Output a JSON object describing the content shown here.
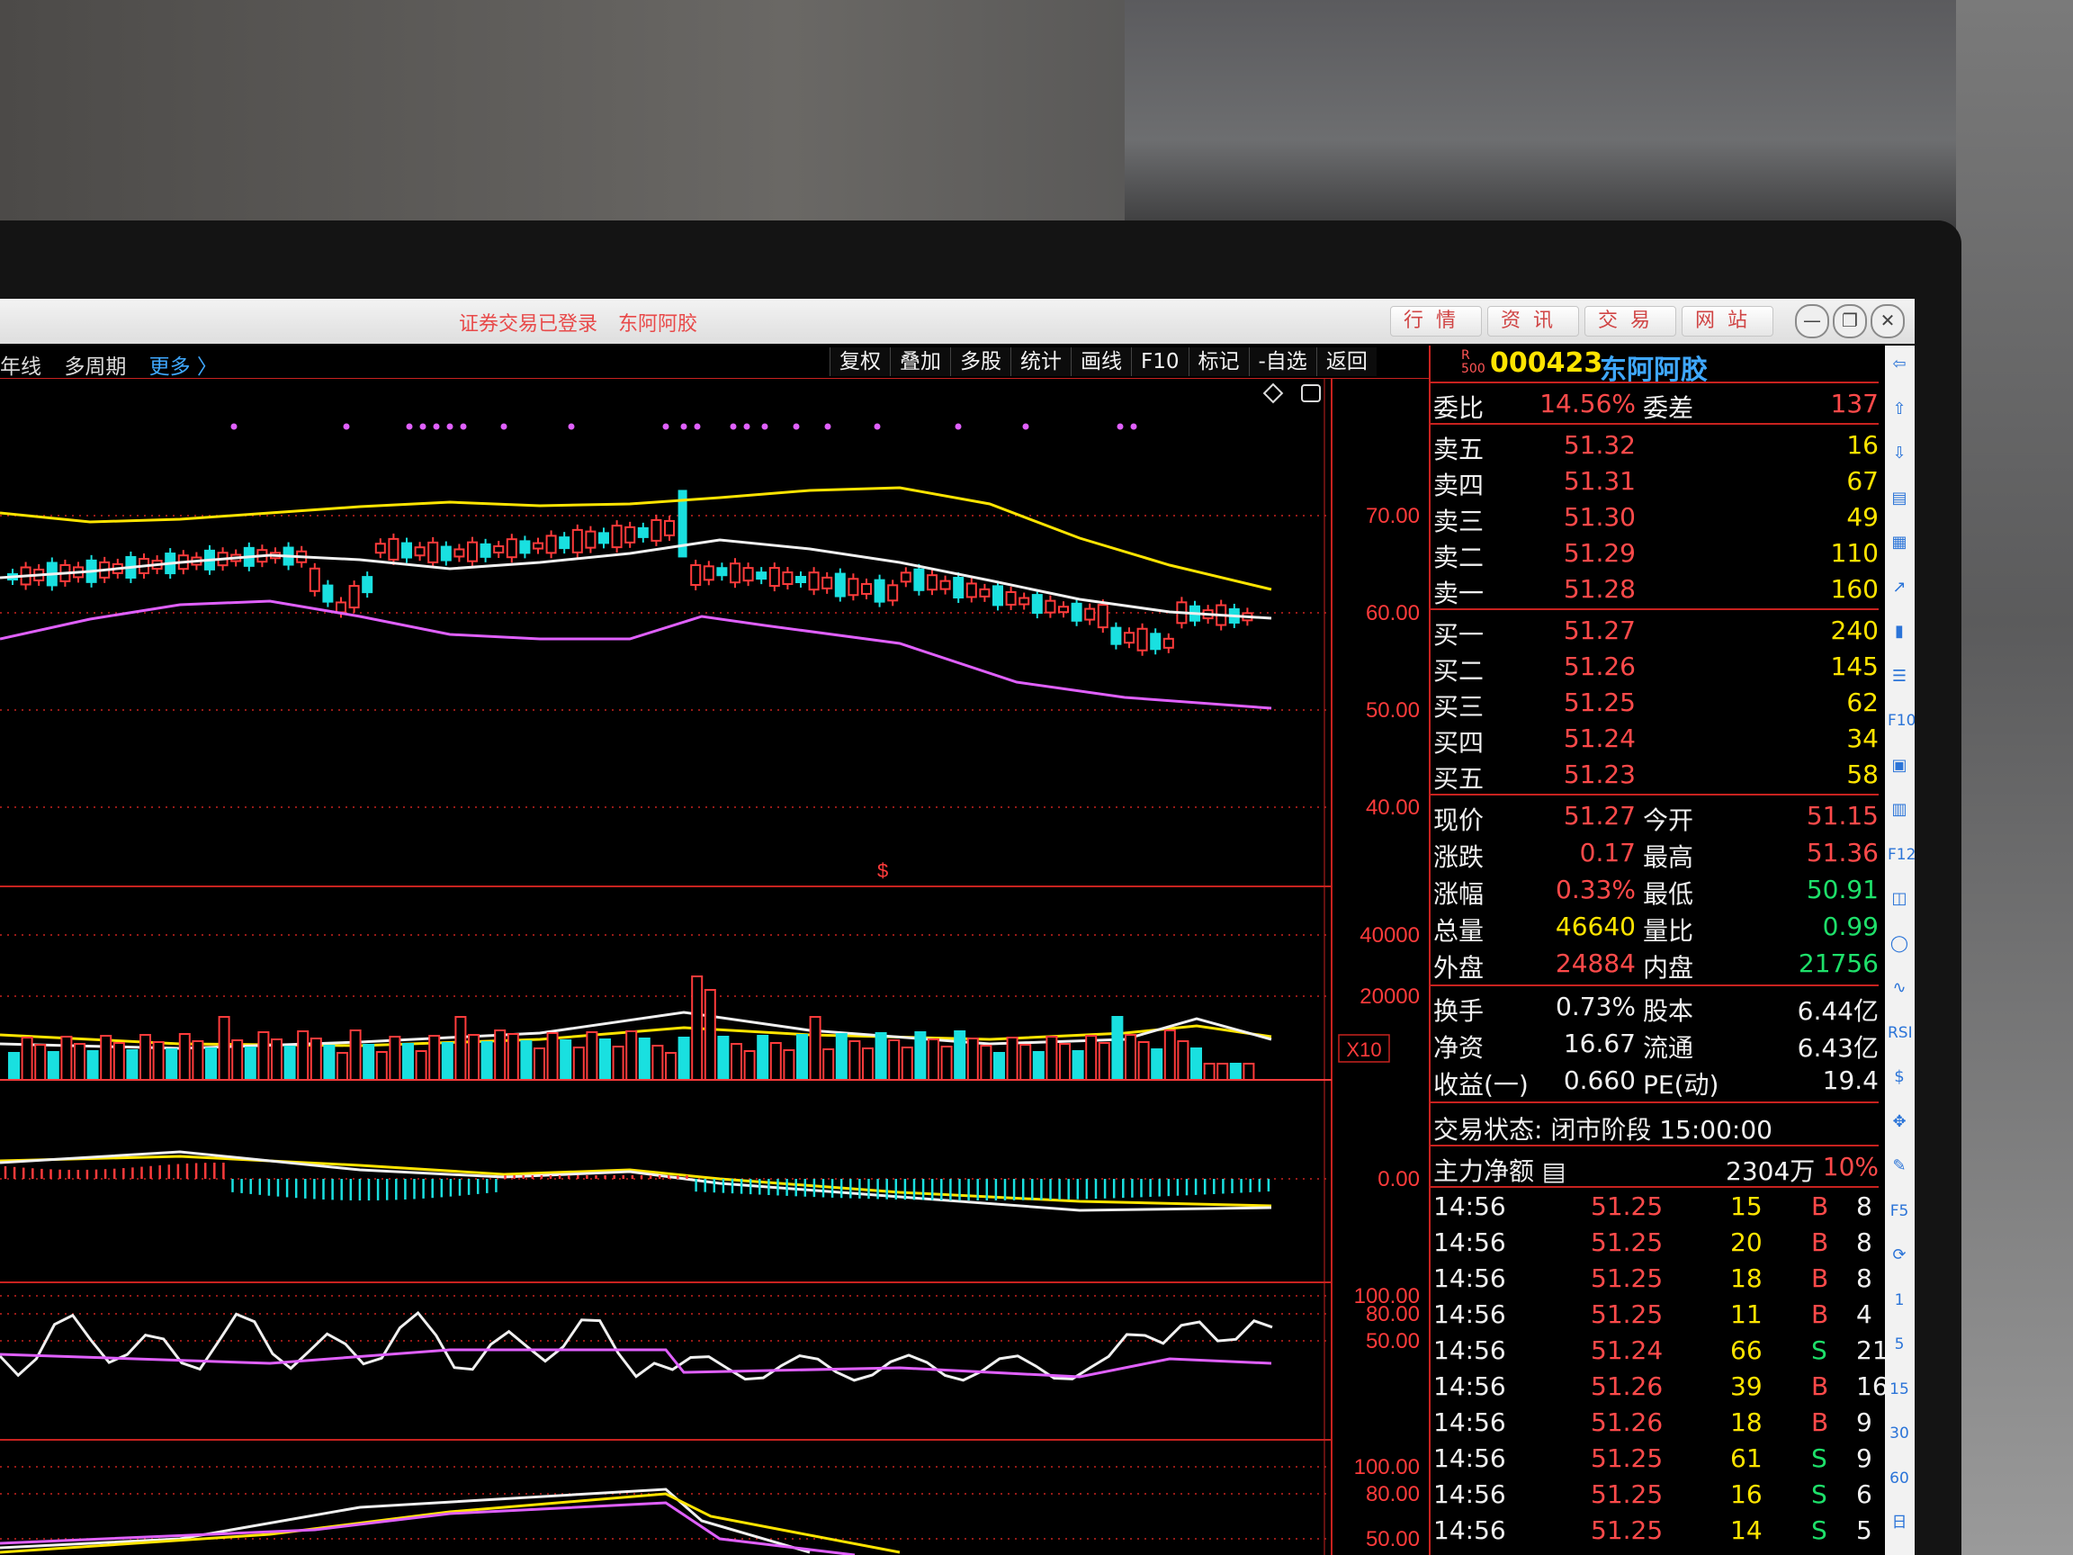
{
  "window": {
    "title_parts": [
      "证券交易已登录",
      "东阿阿胶"
    ],
    "nav_tabs": [
      "行情",
      "资讯",
      "交易",
      "网站"
    ],
    "controls": [
      "—",
      "❐",
      "✕"
    ]
  },
  "toolbar": {
    "left_items": [
      "年线",
      "多周期"
    ],
    "more_label": "更多 〉",
    "buttons": [
      "复权",
      "叠加",
      "多股",
      "统计",
      "画线",
      "F10",
      "标记",
      "-自选",
      "返回"
    ]
  },
  "stock": {
    "badge_r": "R",
    "badge_500": "500",
    "code": "000423",
    "name": "东阿阿胶"
  },
  "quote": {
    "weibi": {
      "label": "委比",
      "value": "14.56%",
      "label2": "委差",
      "value2": "137"
    },
    "asks": [
      {
        "label": "卖五",
        "price": "51.32",
        "vol": "16"
      },
      {
        "label": "卖四",
        "price": "51.31",
        "vol": "67"
      },
      {
        "label": "卖三",
        "price": "51.30",
        "vol": "49"
      },
      {
        "label": "卖二",
        "price": "51.29",
        "vol": "110"
      },
      {
        "label": "卖一",
        "price": "51.28",
        "vol": "160"
      }
    ],
    "bids": [
      {
        "label": "买一",
        "price": "51.27",
        "vol": "240"
      },
      {
        "label": "买二",
        "price": "51.26",
        "vol": "145"
      },
      {
        "label": "买三",
        "price": "51.25",
        "vol": "62"
      },
      {
        "label": "买四",
        "price": "51.24",
        "vol": "34"
      },
      {
        "label": "买五",
        "price": "51.23",
        "vol": "58"
      }
    ],
    "stats": [
      {
        "l1": "现价",
        "v1": "51.27",
        "l2": "今开",
        "v2": "51.15"
      },
      {
        "l1": "涨跌",
        "v1": "0.17",
        "l2": "最高",
        "v2": "51.36"
      },
      {
        "l1": "涨幅",
        "v1": "0.33%",
        "l2": "最低",
        "v2": "50.91"
      },
      {
        "l1": "总量",
        "v1": "46640",
        "l2": "量比",
        "v2": "0.99"
      },
      {
        "l1": "外盘",
        "v1": "24884",
        "l2": "内盘",
        "v2": "21756"
      }
    ],
    "fundamentals": [
      {
        "l1": "换手",
        "v1": "0.73%",
        "l2": "股本",
        "v2": "6.44亿"
      },
      {
        "l1": "净资",
        "v1": "16.67",
        "l2": "流通",
        "v2": "6.43亿"
      },
      {
        "l1": "收益(一)",
        "v1": "0.660",
        "l2": "PE(动)",
        "v2": "19.4"
      }
    ],
    "trade_status": "交易状态: 闭市阶段 15:00:00",
    "main_net": {
      "label": "主力净额",
      "value": "2304万",
      "pct": "10%"
    }
  },
  "ticks": [
    {
      "time": "14:56",
      "price": "51.25",
      "vol": "15",
      "side": "B",
      "n": "8"
    },
    {
      "time": "14:56",
      "price": "51.25",
      "vol": "20",
      "side": "B",
      "n": "8"
    },
    {
      "time": "14:56",
      "price": "51.25",
      "vol": "18",
      "side": "B",
      "n": "8"
    },
    {
      "time": "14:56",
      "price": "51.25",
      "vol": "11",
      "side": "B",
      "n": "4"
    },
    {
      "time": "14:56",
      "price": "51.24",
      "vol": "66",
      "side": "S",
      "n": "21"
    },
    {
      "time": "14:56",
      "price": "51.26",
      "vol": "39",
      "side": "B",
      "n": "16"
    },
    {
      "time": "14:56",
      "price": "51.26",
      "vol": "18",
      "side": "B",
      "n": "9"
    },
    {
      "time": "14:56",
      "price": "51.25",
      "vol": "61",
      "side": "S",
      "n": "9"
    },
    {
      "time": "14:56",
      "price": "51.25",
      "vol": "16",
      "side": "S",
      "n": "6"
    },
    {
      "time": "14:56",
      "price": "51.25",
      "vol": "14",
      "side": "S",
      "n": "5"
    }
  ],
  "axes": {
    "price": [
      "70.00",
      "60.00",
      "50.00",
      "40.00"
    ],
    "volume": [
      "40000",
      "20000"
    ],
    "volume_unit": "X10",
    "macd": [
      "0.00"
    ],
    "ind1": [
      "100.00",
      "80.00",
      "50.00"
    ],
    "ind2": [
      "100.00",
      "80.00",
      "50.00"
    ]
  },
  "right_icons": [
    "arrow-left-icon",
    "arrow-up-icon",
    "arrow-down-icon",
    "report-icon",
    "table-icon",
    "trend-icon",
    "kline-icon",
    "list-icon",
    "F10",
    "news-icon",
    "book-icon",
    "F12",
    "chart-icon",
    "circle-icon",
    "wave-icon",
    "RSI",
    "money-icon",
    "move-icon",
    "pencil-icon",
    "F5",
    "refresh-icon",
    "1",
    "5",
    "15",
    "30",
    "60",
    "日"
  ],
  "colors": {
    "up": "#ff3b3b",
    "down": "#19e0e0",
    "ma_yellow": "#ffe400",
    "ma_white": "#f0f0f0",
    "ma_magenta": "#e060ff",
    "grid_red": "#c8221f"
  }
}
